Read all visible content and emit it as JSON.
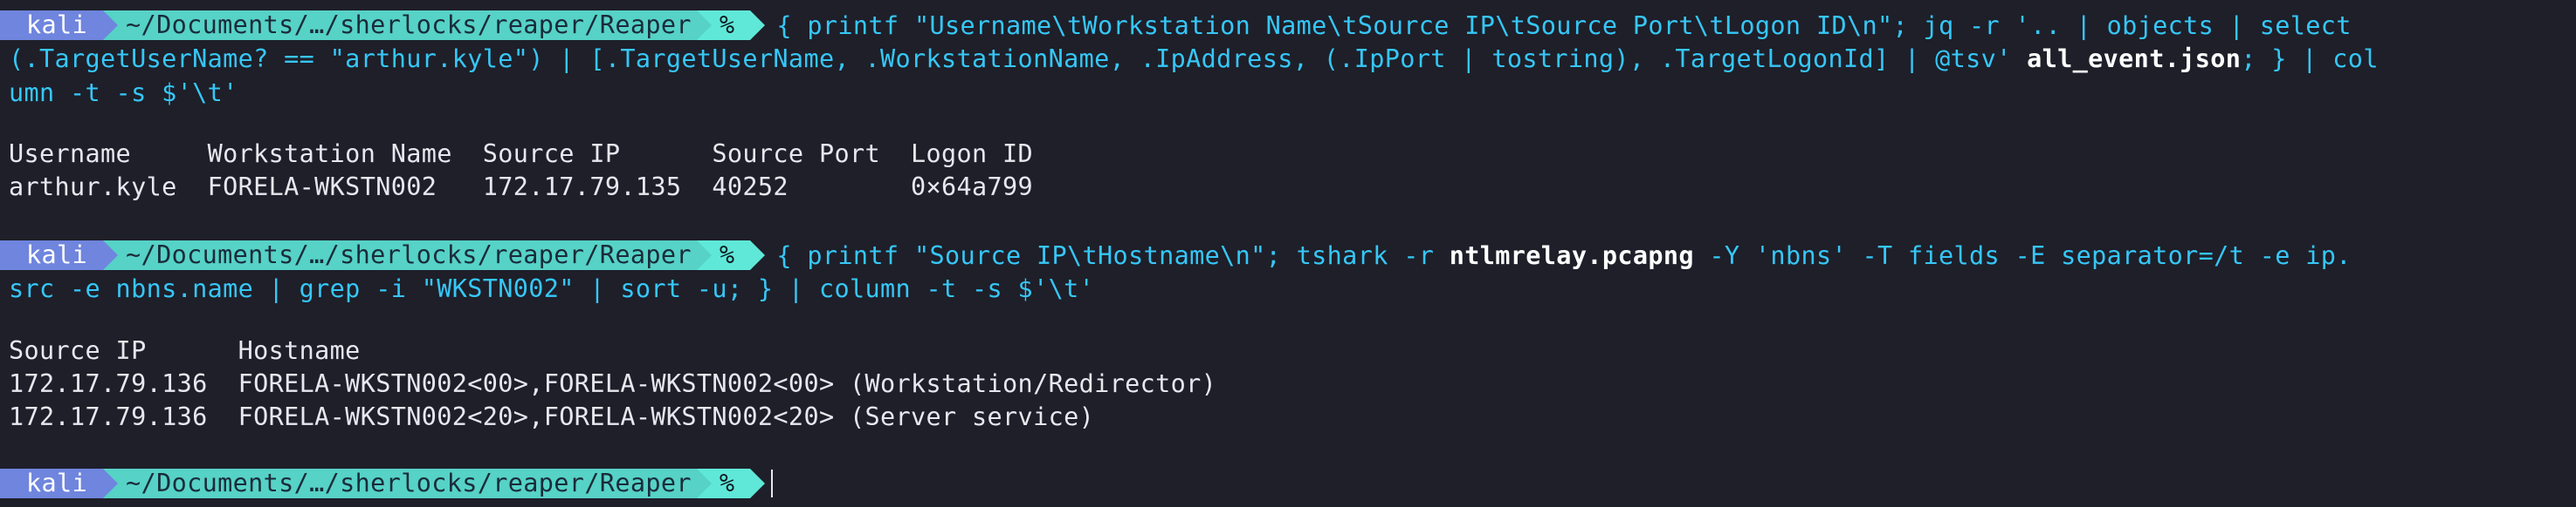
{
  "prompt": {
    "user": "kali",
    "path": "~/Documents/…/sherlocks/reaper/Reaper",
    "symbol": "%"
  },
  "block1": {
    "cmd_line1": "{ printf \"Username\\tWorkstation Name\\tSource IP\\tSource Port\\tLogon ID\\n\"; jq -r '.. | objects | select",
    "cmd_line2a": "(.TargetUserName? == \"arthur.kyle\") | [.TargetUserName, .WorkstationName, .IpAddress, (.IpPort | tostring), .TargetLogonId] | @tsv' ",
    "cmd_line2_file": "all_event.json",
    "cmd_line2b": "; } | col",
    "cmd_line3": "umn -t -s $'\\t'",
    "header": "Username     Workstation Name  Source IP      Source Port  Logon ID",
    "row1": "arthur.kyle  FORELA-WKSTN002   172.17.79.135  40252        0×64a799"
  },
  "block2": {
    "cmd_line1a": "{ printf \"Source IP\\tHostname\\n\"; tshark -r ",
    "cmd_line1_file": "ntlmrelay.pcapng",
    "cmd_line1b": " -Y 'nbns' -T fields -E separator=/t -e ip.",
    "cmd_line2": "src -e nbns.name | grep -i \"WKSTN002\" | sort -u; } | column -t -s $'\\t'",
    "header": "Source IP      Hostname",
    "row1": "172.17.79.136  FORELA-WKSTN002<00>,FORELA-WKSTN002<00> (Workstation/Redirector)",
    "row2": "172.17.79.136  FORELA-WKSTN002<20>,FORELA-WKSTN002<20> (Server service)"
  },
  "colors": {
    "background": "#1e1f29",
    "prompt_user_bg": "#6f85de",
    "prompt_path_bg": "#56d2c6",
    "prompt_symbol_bg": "#5fe8d8",
    "command": "#36c7f7",
    "string": "#f3e57c",
    "text": "#e6e8ee"
  }
}
